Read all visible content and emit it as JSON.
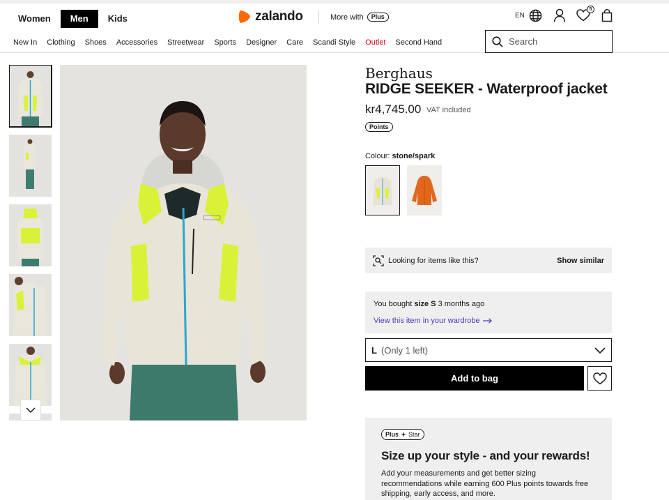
{
  "header": {
    "genders": [
      {
        "label": "Women",
        "active": false
      },
      {
        "label": "Men",
        "active": true
      },
      {
        "label": "Kids",
        "active": false
      }
    ],
    "logo_text": "zalando",
    "more_with": "More with",
    "plus_badge": "Plus",
    "language": "EN",
    "wishlist_count": "5",
    "search_placeholder": "Search",
    "icons": [
      "globe-icon",
      "user-icon",
      "heart-icon",
      "bag-icon",
      "search-icon"
    ]
  },
  "nav": {
    "categories": [
      "New In",
      "Clothing",
      "Shoes",
      "Accessories",
      "Streetwear",
      "Sports",
      "Designer",
      "Care",
      "Scandi Style",
      "Outlet",
      "Second Hand"
    ]
  },
  "product": {
    "brand": "Berghaus",
    "name": "RIDGE SEEKER - Waterproof jacket",
    "price": "kr4,745.00",
    "vat": "VAT included",
    "points_badge": "Points",
    "colour_label": "Colour:",
    "colour_value": "stone/spark",
    "swatches": [
      "stone/spark",
      "orange"
    ]
  },
  "similar": {
    "text": "Looking for items like this?",
    "action": "Show similar"
  },
  "bought": {
    "prefix": "You bought",
    "size": "size S",
    "suffix": "3 months ago",
    "link": "View this item in your wardrobe"
  },
  "size_select": {
    "size": "L",
    "availability": "(Only 1 left)"
  },
  "actions": {
    "add_to_bag": "Add to bag"
  },
  "promo": {
    "badge_plus": "Plus",
    "badge_star": "Star",
    "title": "Size up your style - and your rewards!",
    "body": "Add your measurements and get better sizing recommendations while earning 600 Plus points towards free shipping, early access, and more."
  },
  "colors": {
    "accent_link": "#4a3ab8",
    "outlet": "#d0021b",
    "brand_orange": "#ff6900"
  }
}
